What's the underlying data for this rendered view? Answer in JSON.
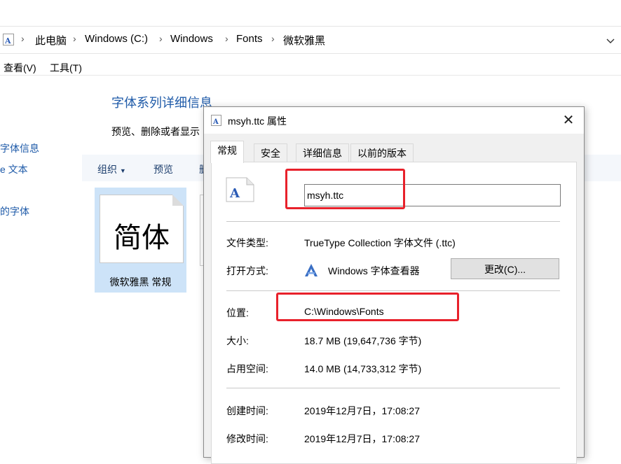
{
  "breadcrumb": {
    "items": [
      "此电脑",
      "Windows (C:)",
      "Windows",
      "Fonts",
      "微软雅黑"
    ]
  },
  "menu": {
    "view": "查看(V)",
    "tools": "工具(T)"
  },
  "explorer": {
    "title": "字体系列详细信息",
    "description": "预览、删除或者显示",
    "nav": [
      "字体信息",
      "e 文本",
      "的字体"
    ],
    "commands": {
      "organize": "组织",
      "preview": "预览",
      "delete_partial": "删"
    },
    "tile": {
      "glyph": "简体",
      "label": "微软雅黑 常规"
    }
  },
  "dialog": {
    "title": "msyh.ttc 属性",
    "tabs": [
      "常规",
      "安全",
      "详细信息",
      "以前的版本"
    ],
    "filename": "msyh.ttc",
    "fields": {
      "type_label": "文件类型:",
      "type_value": "TrueType Collection 字体文件 (.ttc)",
      "open_label": "打开方式:",
      "open_value": "Windows 字体查看器",
      "change_button": "更改(C)...",
      "location_label": "位置:",
      "location_value": "C:\\Windows\\Fonts",
      "size_label": "大小:",
      "size_value": "18.7 MB (19,647,736 字节)",
      "disk_label": "占用空间:",
      "disk_value": "14.0 MB (14,733,312 字节)",
      "created_label": "创建时间:",
      "created_value": "2019年12月7日，17:08:27",
      "modified_label": "修改时间:",
      "modified_value": "2019年12月7日，17:08:27"
    }
  },
  "colors": {
    "annotation": "#e8212b",
    "link": "#1e5aa8",
    "selection": "#cde3f8"
  }
}
